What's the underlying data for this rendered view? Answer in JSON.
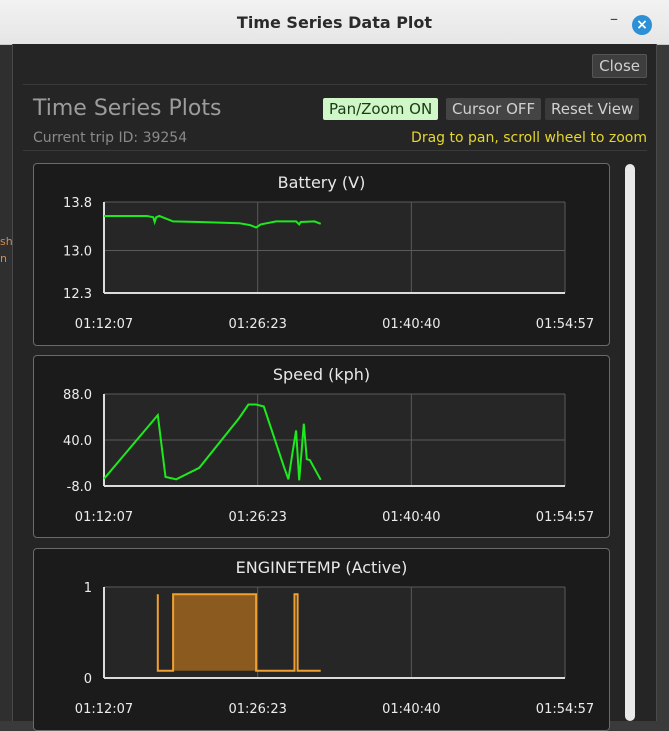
{
  "window": {
    "title": "Time Series Data Plot",
    "close_label": "Close",
    "minimize_glyph": "–",
    "close_glyph": "×"
  },
  "header": {
    "title": "Time Series Plots",
    "trip": "Current trip ID: 39254",
    "pan_label": "Pan/Zoom ON",
    "cursor_label": "Cursor OFF",
    "reset_label": "Reset View",
    "hint": "Drag to pan, scroll wheel to zoom"
  },
  "background_fragments": [
    "sh",
    "n"
  ],
  "colors": {
    "line_green": "#1ee81e",
    "line_orange": "#f0a030",
    "fill_orange": "#8a5a1e",
    "pan_bg": "#cff7c7",
    "hint": "#e5d62e",
    "accent_blue": "#2d8fd6"
  },
  "chart_data": [
    {
      "type": "line",
      "title": "Battery (V)",
      "x_ticks": [
        "01:12:07",
        "01:26:23",
        "01:40:40",
        "01:54:57"
      ],
      "y_ticks": [
        "13.8",
        "13.0",
        "12.3"
      ],
      "ylim": [
        12.3,
        13.8
      ],
      "xlim": [
        0,
        3
      ],
      "grid": true,
      "series": [
        {
          "points": [
            [
              0.0,
              13.57
            ],
            [
              0.28,
              13.57
            ],
            [
              0.32,
              13.55
            ],
            [
              0.33,
              13.47
            ],
            [
              0.34,
              13.55
            ],
            [
              0.36,
              13.57
            ],
            [
              0.38,
              13.55
            ],
            [
              0.45,
              13.48
            ],
            [
              0.62,
              13.47
            ],
            [
              0.88,
              13.45
            ],
            [
              0.95,
              13.42
            ],
            [
              0.99,
              13.38
            ],
            [
              1.02,
              13.43
            ],
            [
              1.12,
              13.48
            ],
            [
              1.25,
              13.48
            ],
            [
              1.27,
              13.43
            ],
            [
              1.28,
              13.47
            ],
            [
              1.37,
              13.48
            ],
            [
              1.41,
              13.44
            ]
          ]
        }
      ]
    },
    {
      "type": "line",
      "title": "Speed (kph)",
      "x_ticks": [
        "01:12:07",
        "01:26:23",
        "01:40:40",
        "01:54:57"
      ],
      "y_ticks": [
        "88.0",
        "40.0",
        "-8.0"
      ],
      "ylim": [
        -8,
        88
      ],
      "xlim": [
        0,
        3
      ],
      "grid": true,
      "series": [
        {
          "points": [
            [
              0.0,
              -0.5
            ],
            [
              0.35,
              66.0
            ],
            [
              0.4,
              1.5
            ],
            [
              0.47,
              -1.0
            ],
            [
              0.62,
              11.0
            ],
            [
              0.88,
              63.0
            ],
            [
              0.94,
              77.0
            ],
            [
              0.99,
              77.0
            ],
            [
              1.04,
              75.0
            ],
            [
              1.17,
              12.5
            ],
            [
              1.2,
              -1.0
            ],
            [
              1.23,
              30.0
            ],
            [
              1.25,
              50.0
            ],
            [
              1.27,
              -2.0
            ],
            [
              1.29,
              36.0
            ],
            [
              1.3,
              57.0
            ],
            [
              1.32,
              20.0
            ],
            [
              1.34,
              19.0
            ],
            [
              1.41,
              -1.5
            ]
          ]
        }
      ]
    },
    {
      "type": "area",
      "title": "ENGINETEMP (Active)",
      "x_ticks": [
        "01:12:07",
        "01:26:23",
        "01:40:40",
        "01:54:57"
      ],
      "y_ticks": [
        "1",
        "0"
      ],
      "ylim": [
        0,
        1
      ],
      "xlim": [
        0,
        3
      ],
      "grid": true,
      "series": [
        {
          "points": [
            [
              0.35,
              0.92
            ],
            [
              0.35,
              0.08
            ],
            [
              0.45,
              0.08
            ],
            [
              0.45,
              0.92
            ],
            [
              0.99,
              0.92
            ],
            [
              0.99,
              0.08
            ],
            [
              1.24,
              0.08
            ],
            [
              1.24,
              0.92
            ],
            [
              1.26,
              0.92
            ],
            [
              1.26,
              0.08
            ],
            [
              1.41,
              0.08
            ]
          ]
        }
      ]
    }
  ]
}
